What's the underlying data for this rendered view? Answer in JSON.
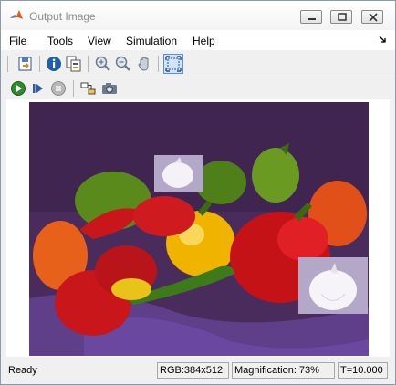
{
  "window": {
    "title": "Output Image"
  },
  "menu": [
    "File",
    "Tools",
    "View",
    "Simulation",
    "Help"
  ],
  "toolbar": {
    "row1": [
      "save-icon",
      "info-icon",
      "copy-params-icon",
      "zoom-in-icon",
      "zoom-out-icon",
      "pan-icon",
      "fit-to-window-icon"
    ],
    "row2": [
      "run-icon",
      "step-forward-icon",
      "stop-icon",
      "highlight-block-icon",
      "snapshot-icon"
    ]
  },
  "status": {
    "ready": "Ready",
    "rgb": "RGB:384x512",
    "magnification": "Magnification: 73%",
    "time": "T=10.000"
  },
  "colors": {
    "background": "#4b2e5f",
    "cloth": "#5f3e8a",
    "red_pepper": "#c8161b",
    "green_pepper": "#5a8a1c",
    "yellow_pepper": "#f0b400",
    "orange_pepper": "#e8611a",
    "garlic_box": "#b3a8c8"
  }
}
